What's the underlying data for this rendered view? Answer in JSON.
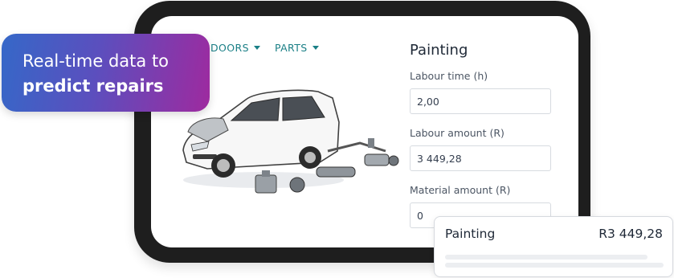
{
  "badge": {
    "line1": "Real-time data to",
    "line2": "predict repairs"
  },
  "nav": {
    "doors": "DOORS",
    "parts": "PARTS"
  },
  "form": {
    "title": "Painting",
    "fields": [
      {
        "label": "Labour time (h)",
        "value": "2,00"
      },
      {
        "label": "Labour amount (R)",
        "value": "3 449,28"
      },
      {
        "label": "Material amount (R)",
        "value": "0"
      }
    ]
  },
  "summary": {
    "title": "Painting",
    "amount": "R3 449,28"
  },
  "colors": {
    "accent": "#1a7f86",
    "badge_start": "#3568c8",
    "badge_end": "#9e2a9f",
    "frame": "#1e1e1e"
  }
}
